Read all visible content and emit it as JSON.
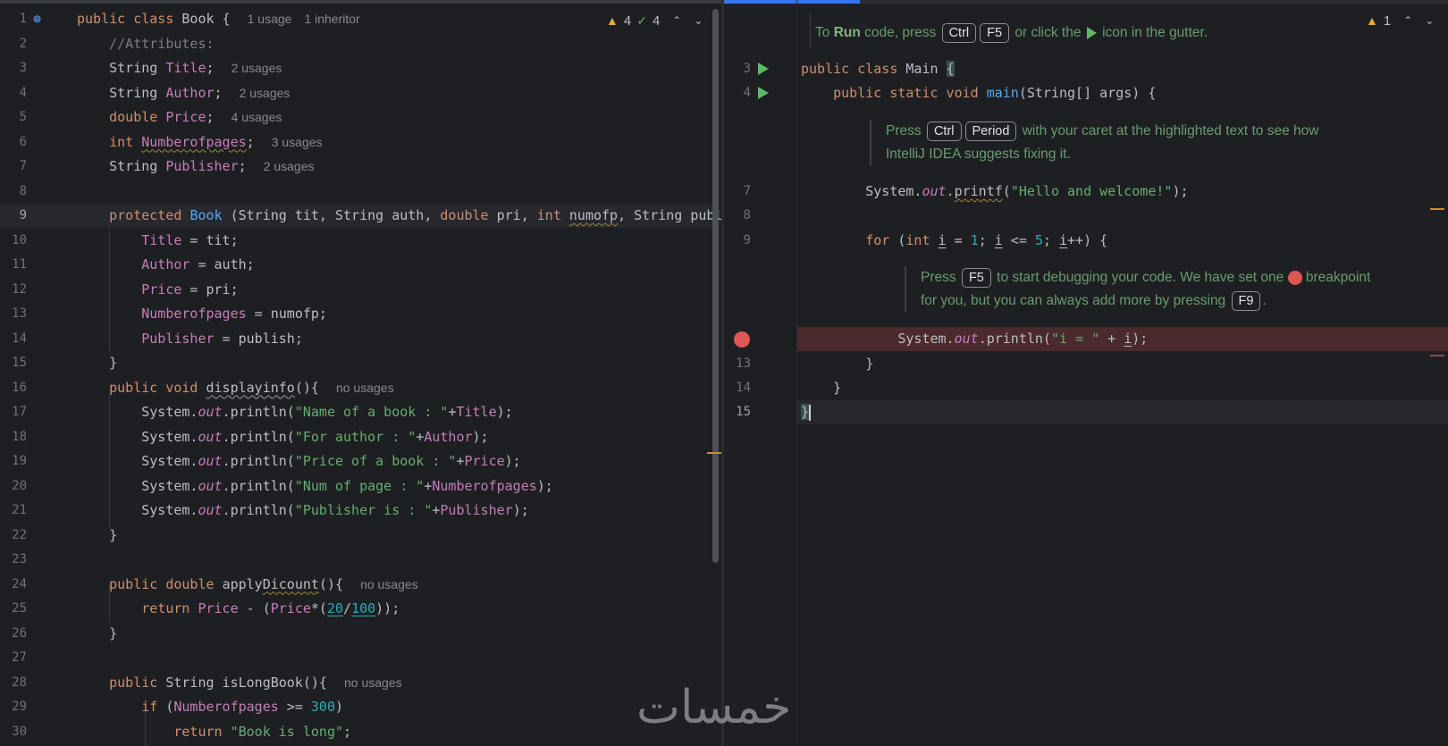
{
  "left_editor": {
    "status": {
      "warnings": "4",
      "weak_warnings": "4"
    },
    "lines": [
      {
        "n": "1",
        "html": "<span class='kw'>public class </span><span class='cls'>Book</span> { <span class='hint'>1 usage</span><span class='hint hint-sp'>1 inheritor</span>"
      },
      {
        "n": "2",
        "html": "    <span class='cmt'>//Attributes:</span>"
      },
      {
        "n": "3",
        "html": "    String <span class='field'>Title</span>; <span class='hint'>2 usages</span>"
      },
      {
        "n": "4",
        "html": "    String <span class='field'>Author</span>; <span class='hint'>2 usages</span>"
      },
      {
        "n": "5",
        "html": "    <span class='kw'>double </span><span class='field'>Price</span>; <span class='hint'>4 usages</span>"
      },
      {
        "n": "6",
        "html": "    <span class='kw'>int </span><span class='field wavy'>Numberofpages</span>; <span class='hint'>3 usages</span>"
      },
      {
        "n": "7",
        "html": "    String <span class='field'>Publisher</span>; <span class='hint'>2 usages</span>"
      },
      {
        "n": "8",
        "html": ""
      },
      {
        "n": "9",
        "html": "    <span class='kw'>protected </span><span class='fn'>Book</span> (String tit, String auth, <span class='kw'>double </span>pri, <span class='kw'>int </span><span class='wavy'>numofp</span>, String publish){"
      },
      {
        "n": "10",
        "html": "        <span class='field'>Title</span> = tit;"
      },
      {
        "n": "11",
        "html": "        <span class='field'>Author</span> = auth;"
      },
      {
        "n": "12",
        "html": "        <span class='field'>Price</span> = pri;"
      },
      {
        "n": "13",
        "html": "        <span class='field'>Numberofpages</span> = numofp;"
      },
      {
        "n": "14",
        "html": "        <span class='field'>Publisher</span> = publish;"
      },
      {
        "n": "15",
        "html": "    }"
      },
      {
        "n": "16",
        "html": "    <span class='kw'>public void </span><span class='unused'>displayinfo</span>(){ <span class='hint'>no usages</span>"
      },
      {
        "n": "17",
        "html": "        System.<span class='stat'>out</span>.println(<span class='str'>\"Name of a book : \"</span>+<span class='field'>Title</span>);"
      },
      {
        "n": "18",
        "html": "        System.<span class='stat'>out</span>.println(<span class='str'>\"For author : \"</span>+<span class='field'>Author</span>);"
      },
      {
        "n": "19",
        "html": "        System.<span class='stat'>out</span>.println(<span class='str'>\"Price of a book : \"</span>+<span class='field'>Price</span>);"
      },
      {
        "n": "20",
        "html": "        System.<span class='stat'>out</span>.println(<span class='str'>\"Num of page : \"</span>+<span class='field'>Numberofpages</span>);"
      },
      {
        "n": "21",
        "html": "        System.<span class='stat'>out</span>.println(<span class='str'>\"Publisher is : \"</span>+<span class='field'>Publisher</span>);"
      },
      {
        "n": "22",
        "html": "    }"
      },
      {
        "n": "23",
        "html": ""
      },
      {
        "n": "24",
        "html": "    <span class='kw'>public double </span>apply<span class='wavy'>Dicount</span>(){ <span class='hint'>no usages</span>"
      },
      {
        "n": "25",
        "html": "        <span class='kw'>return </span><span class='field'>Price</span> - (<span class='field'>Price</span>*(<span class='num uline'>20</span>/<span class='num uline'>100</span>));"
      },
      {
        "n": "26",
        "html": "    }"
      },
      {
        "n": "27",
        "html": ""
      },
      {
        "n": "28",
        "html": "    <span class='kw'>public </span>String isLongBook(){ <span class='hint'>no usages</span>"
      },
      {
        "n": "29",
        "html": "        <span class='kw'>if </span>(<span class='field'>Numberofpages</span> >= <span class='num'>300</span>)"
      },
      {
        "n": "30",
        "html": "            <span class='kw'>return </span><span class='str'>\"Book is long\"</span>;"
      }
    ]
  },
  "right_editor": {
    "status": {
      "warnings": "1"
    },
    "tip_run": {
      "prefix": "To ",
      "run": "Run",
      "mid": " code, press ",
      "k1": "Ctrl",
      "k2": "F5",
      "after": " or click the ",
      "suffix": " icon in the gutter."
    },
    "tip_fix": {
      "prefix": "Press ",
      "k1": "Ctrl",
      "k2": "Period",
      "after": " with your caret at the highlighted text to see how",
      "line2": "IntelliJ IDEA suggests fixing it."
    },
    "tip_debug": {
      "prefix": "Press ",
      "k1": "F5",
      "after1": " to start debugging your code. We have set one ",
      "after2": " breakpoint",
      "line2a": "for you, but you can always add more by pressing ",
      "k2": "F9",
      "line2b": "."
    },
    "lines": [
      {
        "n": "3",
        "html": "<span class='kw'>public class </span>Main <span class='brace-hl'>{</span>"
      },
      {
        "n": "4",
        "html": "    <span class='kw'>public static void </span><span class='fn'>main</span>(String[] args) {"
      },
      {
        "n": "7",
        "html": "        System.<span class='stat'>out</span>.<span class='wavy'>printf</span>(<span class='str'>\"Hello and welcome!\"</span>);"
      },
      {
        "n": "8",
        "html": ""
      },
      {
        "n": "9",
        "html": "        <span class='kw'>for </span>(<span class='kw'>int </span><span class='uline'>i</span> = <span class='num'>1</span>; <span class='uline'>i</span> &lt;= <span class='num'>5</span>; <span class='uline'>i</span>++) {"
      },
      {
        "n": "",
        "html": "            System.<span class='stat'>out</span>.println(<span class='str'>\"i = \"</span> + <span class='uline'>i</span>);"
      },
      {
        "n": "13",
        "html": "        }"
      },
      {
        "n": "14",
        "html": "    }"
      },
      {
        "n": "15",
        "html": "<span class='brace-hl'>}</span><span class='caret'></span>"
      }
    ]
  },
  "watermark": "خمسات",
  "colors": {
    "accent": "#3574f0",
    "breakpoint": "#e05555",
    "run": "#5fb865",
    "warning": "#e9a93b"
  }
}
